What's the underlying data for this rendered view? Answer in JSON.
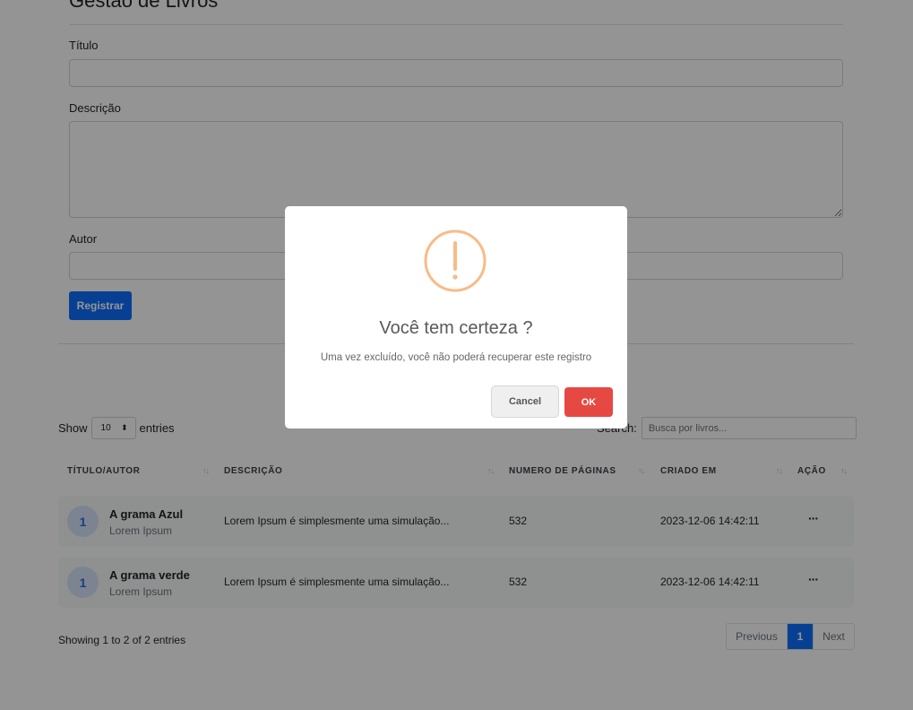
{
  "page": {
    "title": "Gestão de Livros"
  },
  "form": {
    "titulo_label": "Título",
    "titulo_value": "",
    "descricao_label": "Descrição",
    "descricao_value": "",
    "autor_label": "Autor",
    "autor_value": "",
    "submit_label": "Registrar"
  },
  "table_controls": {
    "show_label": "Show",
    "entries_value": "10",
    "entries_label": "entries",
    "search_label": "Search:",
    "search_placeholder": "Busca por livros..."
  },
  "table": {
    "columns": [
      "TÍTULO/AUTOR",
      "DESCRIÇÃO",
      "NUMERO DE PÁGINAS",
      "CRIADO EM",
      "AÇÃO"
    ],
    "rows": [
      {
        "avatar": "1",
        "title": "A grama Azul",
        "author": "Lorem Ipsum",
        "description": "Lorem Ipsum é simplesmente uma simulação...",
        "pages": "532",
        "created": "2023-12-06 14:42:11",
        "action": "···"
      },
      {
        "avatar": "1",
        "title": "A grama verde",
        "author": "Lorem Ipsum",
        "description": "Lorem Ipsum é simplesmente uma simulação...",
        "pages": "532",
        "created": "2023-12-06 14:42:11",
        "action": "···"
      }
    ]
  },
  "footer": {
    "info": "Showing 1 to 2 of 2 entries",
    "prev": "Previous",
    "page": "1",
    "next": "Next"
  },
  "modal": {
    "icon": "warning-icon",
    "title": "Você tem certeza ?",
    "text": "Uma vez excluído, você não poderá recuperar este registro",
    "cancel": "Cancel",
    "ok": "OK"
  },
  "colors": {
    "primary": "#0d6efd",
    "danger": "#e64942",
    "warning": "#f8bb86"
  }
}
